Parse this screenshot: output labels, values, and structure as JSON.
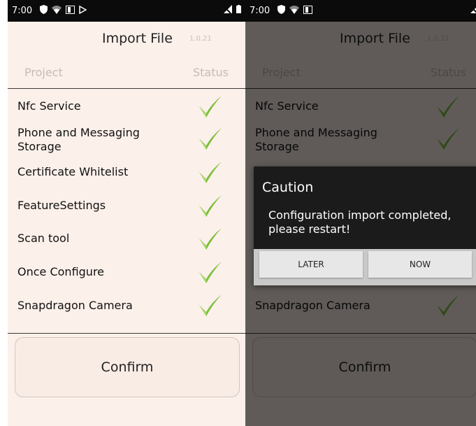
{
  "status_bar": {
    "time": "7:00"
  },
  "header": {
    "title": "Import File",
    "version": "1.0.21"
  },
  "columns": {
    "project": "Project",
    "status": "Status"
  },
  "items": [
    {
      "label": "Nfc Service"
    },
    {
      "label": "Phone and Messaging Storage"
    },
    {
      "label": "Certificate Whitelist"
    },
    {
      "label": "FeatureSettings"
    },
    {
      "label": "Scan tool"
    },
    {
      "label": "Once Configure"
    },
    {
      "label": "Snapdragon Camera"
    }
  ],
  "confirm_label": "Confirm",
  "dialog": {
    "title": "Caution",
    "message": "Configuration import completed, please restart!",
    "later_label": "LATER",
    "now_label": "NOW"
  },
  "colors": {
    "check_green": "#7bbf3a",
    "background": "#fcf0ea"
  }
}
